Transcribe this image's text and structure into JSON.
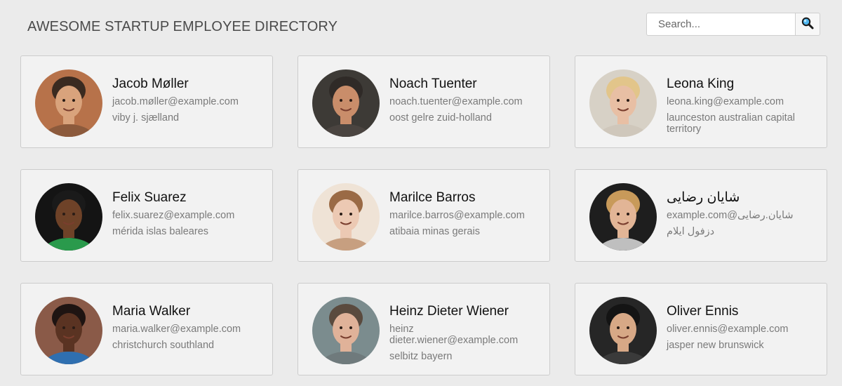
{
  "header": {
    "title": "AWESOME STARTUP EMPLOYEE DIRECTORY",
    "search": {
      "placeholder": "Search...",
      "value": "",
      "button_icon": "search-icon"
    }
  },
  "employees": [
    {
      "name": "Jacob Møller",
      "email": "jacob.møller@example.com",
      "location": "viby j. sjælland",
      "avatar": {
        "bg": "#b7724a",
        "skin": "#d9a37c",
        "hair": "#3a2a20",
        "shirt": "#8c5a3c"
      }
    },
    {
      "name": "Noach Tuenter",
      "email": "noach.tuenter@example.com",
      "location": "oost gelre zuid-holland",
      "avatar": {
        "bg": "#3d3a36",
        "skin": "#c98d6a",
        "hair": "#2f2a27",
        "shirt": "#4a4440"
      }
    },
    {
      "name": "Leona King",
      "email": "leona.king@example.com",
      "location": "launceston australian capital territory",
      "avatar": {
        "bg": "#d7d1c6",
        "skin": "#e8bfa4",
        "hair": "#e2c58a",
        "shirt": "#cfc7bb"
      }
    },
    {
      "name": "Felix Suarez",
      "email": "felix.suarez@example.com",
      "location": "mérida islas baleares",
      "avatar": {
        "bg": "#141414",
        "skin": "#6e4228",
        "hair": "#1a1a1a",
        "shirt": "#2a9a4c"
      }
    },
    {
      "name": "Marilce Barros",
      "email": "marilce.barros@example.com",
      "location": "atibaia minas gerais",
      "avatar": {
        "bg": "#efe3d6",
        "skin": "#ecc9b3",
        "hair": "#9a6a45",
        "shirt": "#c79f80"
      }
    },
    {
      "name": "شایان رضایی",
      "email": "شایان.رضایی@example.com",
      "location": "دزفول ایلام",
      "avatar": {
        "bg": "#1e1e1e",
        "skin": "#e2b596",
        "hair": "#c89a5a",
        "shirt": "#bfbfbf"
      }
    },
    {
      "name": "Maria Walker",
      "email": "maria.walker@example.com",
      "location": "christchurch southland",
      "avatar": {
        "bg": "#8a5a48",
        "skin": "#5a3322",
        "hair": "#1e1412",
        "shirt": "#2f6fb0"
      }
    },
    {
      "name": "Heinz Dieter Wiener",
      "email": "heinz dieter.wiener@example.com",
      "location": "selbitz bayern",
      "avatar": {
        "bg": "#7b8c8e",
        "skin": "#e0b299",
        "hair": "#5a4a3e",
        "shirt": "#6f7a7c"
      }
    },
    {
      "name": "Oliver Ennis",
      "email": "oliver.ennis@example.com",
      "location": "jasper new brunswick",
      "avatar": {
        "bg": "#262626",
        "skin": "#d7a886",
        "hair": "#141414",
        "shirt": "#3a3a3a"
      }
    }
  ],
  "colors": {
    "page_bg": "#ebebeb",
    "card_bg": "#f2f2f2",
    "card_border": "#cccccc",
    "title": "#4a4a4a",
    "muted_text": "#7a7a7a",
    "search_icon": "#1f7fd6"
  }
}
